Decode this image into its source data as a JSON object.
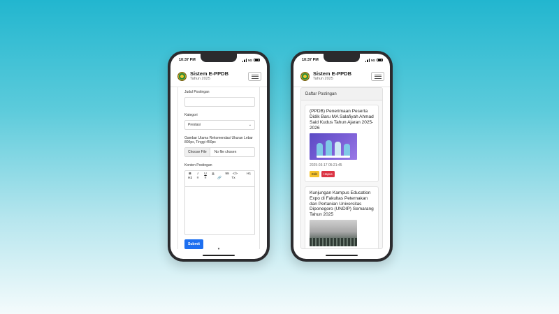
{
  "status_bar": {
    "time": "10:37 PM",
    "network": "5G"
  },
  "navbar": {
    "title": "Sistem E-PPDB",
    "subtitle": "Tahun 2025",
    "logo_icon": "school-emblem-icon",
    "menu_icon": "hamburger-menu-icon"
  },
  "form": {
    "title_label": "Judul Postingan",
    "title_value": "",
    "category_label": "Kategori",
    "category_value": "Prestasi",
    "image_label": "Gambar Utama Rekomendasi Ukuran Lebar 800px, Tinggi 450px",
    "file_button": "Choose File",
    "file_status": "No file chosen",
    "content_label": "Konten Postingan",
    "toolbar": [
      "B",
      "I",
      "U",
      "S",
      "99",
      "</>",
      "H1",
      "H2",
      "≡",
      "≡",
      "🔗",
      "Tx"
    ],
    "submit_label": "Submit"
  },
  "list": {
    "header": "Daftar Postingan",
    "posts": [
      {
        "title": "(PPDB) Penerimaan Peserta Didik Baru MA Salafiyah Ahmad Said Kudus Tahun Ajaran 2025-2026",
        "date": "2025-03-17 05:21:45",
        "edit_label": "Edit",
        "delete_label": "Hapus"
      },
      {
        "title": "Kunjungan Kampus Education Expo di Fakultas Peternakan dan Pertanian Universitas Diponegoro (UNDIP) Semarang Tahun 2025"
      }
    ]
  },
  "colors": {
    "primary": "#1d6ff0",
    "edit": "#f5c22c",
    "delete": "#dc3545"
  }
}
